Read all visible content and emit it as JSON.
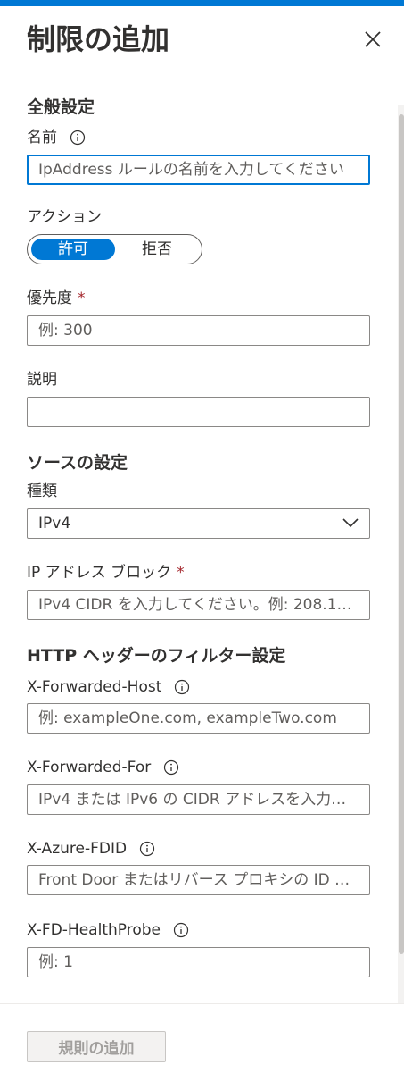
{
  "panel": {
    "title": "制限の追加"
  },
  "general": {
    "heading": "全般設定",
    "name_label": "名前",
    "name_placeholder": "IpAddress ルールの名前を入力してください",
    "action_label": "アクション",
    "action_allow": "許可",
    "action_deny": "拒否",
    "priority_label": "優先度",
    "priority_placeholder": "例: 300",
    "description_label": "説明",
    "description_value": ""
  },
  "source": {
    "heading": "ソースの設定",
    "type_label": "種類",
    "type_value": "IPv4",
    "block_label": "IP アドレス ブロック",
    "block_placeholder": "IPv4 CIDR を入力してください。例: 208.130...."
  },
  "http": {
    "heading": "HTTP ヘッダーのフィルター設定",
    "host_label": "X-Forwarded-Host",
    "host_placeholder": "例: exampleOne.com, exampleTwo.com",
    "for_label": "X-Forwarded-For",
    "for_placeholder": "IPv4 または IPv6 の CIDR アドレスを入力して...",
    "fdid_label": "X-Azure-FDID",
    "fdid_placeholder": "Front Door またはリバース プロキシの ID を...",
    "probe_label": "X-FD-HealthProbe",
    "probe_placeholder": "例: 1"
  },
  "required_mark": "*",
  "footer": {
    "add_button": "規則の追加"
  },
  "colors": {
    "accent": "#0078d4",
    "required": "#a4262c",
    "text": "#323130"
  }
}
